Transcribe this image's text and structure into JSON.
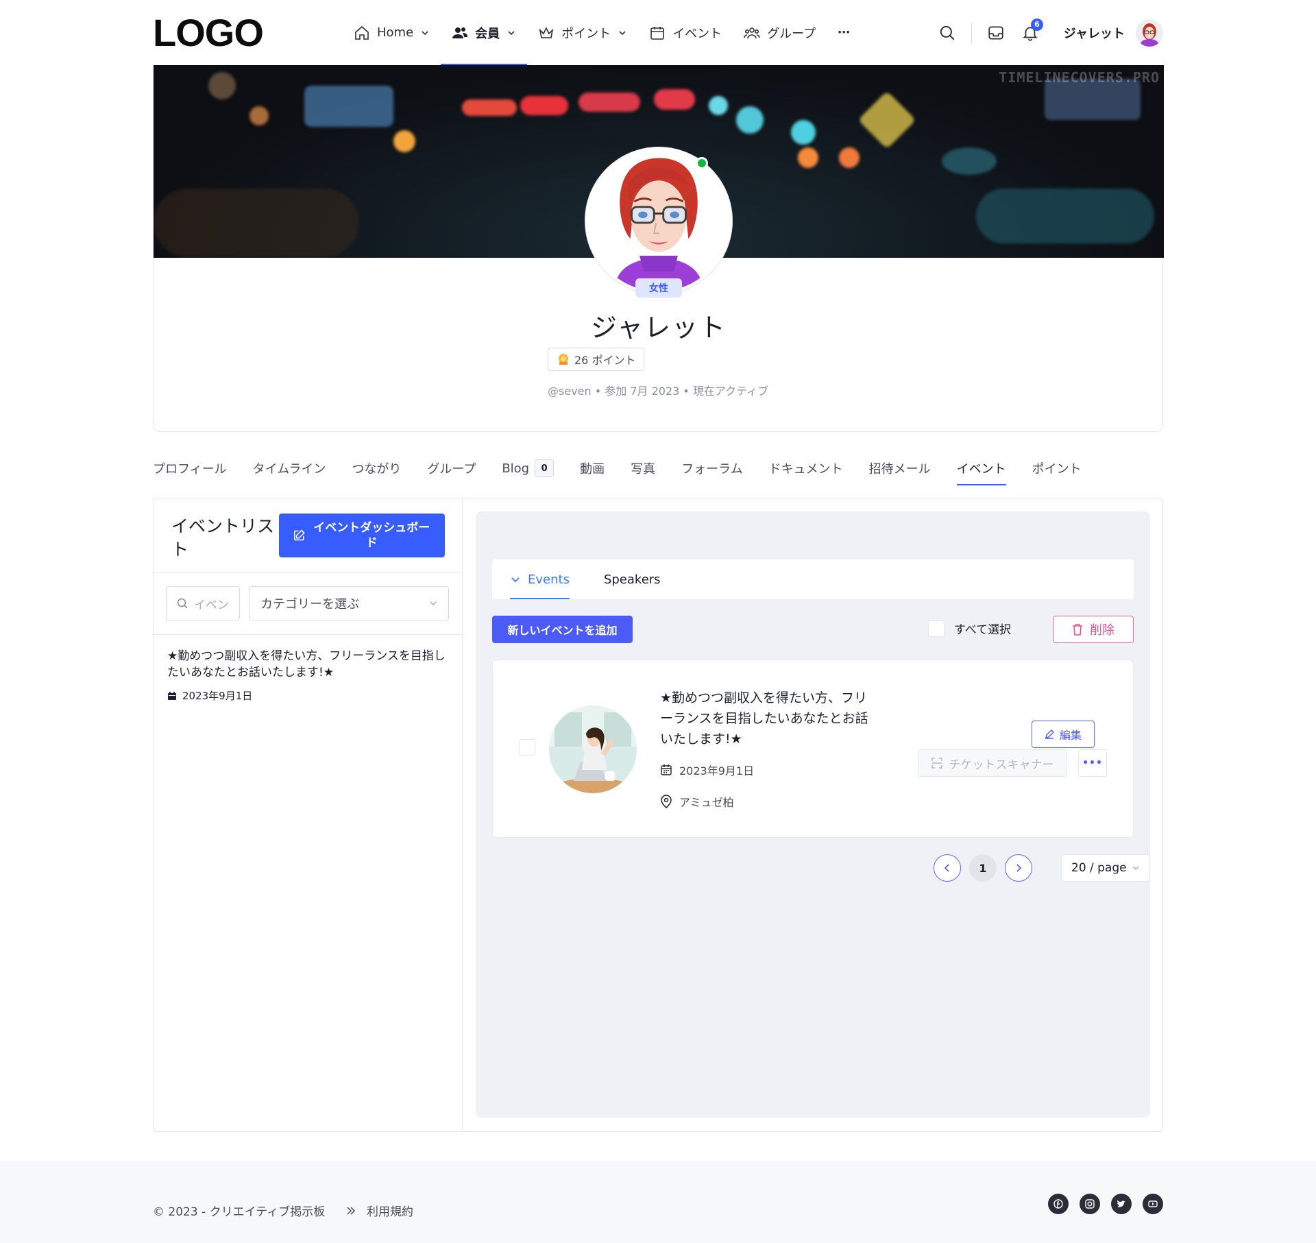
{
  "header": {
    "logo": "LOGO",
    "nav": [
      {
        "label": "Home",
        "icon": "home-icon",
        "dropdown": true
      },
      {
        "label": "会員",
        "icon": "members-icon",
        "dropdown": true,
        "active": true
      },
      {
        "label": "ポイント",
        "icon": "crown-icon",
        "dropdown": true
      },
      {
        "label": "イベント",
        "icon": "calendar-icon",
        "dropdown": false
      },
      {
        "label": "グループ",
        "icon": "group-icon",
        "dropdown": false
      }
    ],
    "more": "⋯",
    "notification_count": "6",
    "user_name": "ジャレット"
  },
  "cover": {
    "watermark": "TIMELINECOVERS.PRO"
  },
  "profile": {
    "gender": "女性",
    "name": "ジャレット",
    "points": "26 ポイント",
    "meta": "@seven • 参加 7月 2023 • 現在アクティブ",
    "status_color": "#19b341"
  },
  "profile_tabs": [
    {
      "label": "プロフィール"
    },
    {
      "label": "タイムライン"
    },
    {
      "label": "つながり"
    },
    {
      "label": "グループ"
    },
    {
      "label": "Blog",
      "count": "0"
    },
    {
      "label": "動画"
    },
    {
      "label": "写真"
    },
    {
      "label": "フォーラム"
    },
    {
      "label": "ドキュメント"
    },
    {
      "label": "招待メール"
    },
    {
      "label": "イベント",
      "active": true
    },
    {
      "label": "ポイント"
    }
  ],
  "left_panel": {
    "title": "イベントリスト",
    "dashboard_button": "イベントダッシュボード",
    "search_placeholder": "イベン",
    "category_select": "カテゴリーを選ぶ",
    "event_title": "★勤めつつ副収入を得たい方、フリーランスを目指したいあなたとお話いたします!★",
    "event_date": "2023年9月1日"
  },
  "right_panel": {
    "tabs": [
      {
        "label": "Events",
        "active": true
      },
      {
        "label": "Speakers"
      }
    ],
    "add_button": "新しいイベントを追加",
    "select_all": "すべて選択",
    "delete_button": "削除",
    "event": {
      "title": "★勤めつつ副収入を得たい方、フリーランスを目指したいあなたとお話いたします!★",
      "date": "2023年9月1日",
      "location": "アミュゼ柏",
      "edit_button": "編集",
      "ticket_button": "チケットスキャナー",
      "more_button": "•••"
    },
    "pager": {
      "prev": "<",
      "current": "1",
      "next": ">",
      "page_size": "20 / page"
    }
  },
  "footer": {
    "copyright": "© 2023 - クリエイティブ掲示板",
    "terms": "利用規約",
    "socials": [
      "facebook-icon",
      "instagram-icon",
      "twitter-icon",
      "youtube-icon"
    ]
  },
  "colors": {
    "accent": "#385dff",
    "button_primary": "#4c5bf5",
    "danger": "#f04f8a",
    "panel_bg": "#f0f1f6"
  }
}
